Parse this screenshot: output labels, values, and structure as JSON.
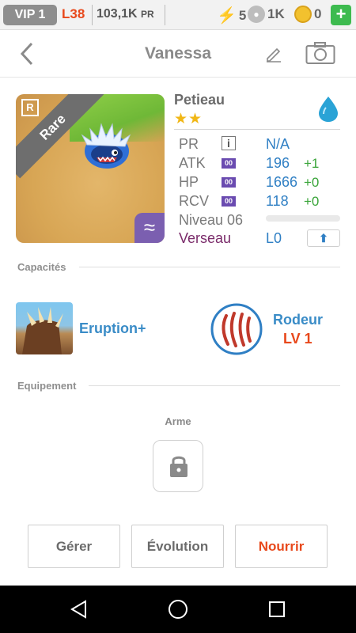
{
  "status_bar": {
    "vip": "VIP 1",
    "level": "L38",
    "pr_value": "103,1K",
    "pr_unit": "PR",
    "energy": "5",
    "paws": "1K",
    "coins": "0",
    "plus_label": "+"
  },
  "header": {
    "back_glyph": "‹",
    "title": "Vanessa",
    "icons": [
      "pencil-icon",
      "camera-icon"
    ]
  },
  "card": {
    "rarity": "Rare",
    "rarity_badge": "R",
    "element_glyph": "≈",
    "colors": {
      "banner": "#6e6e6e",
      "element_corner": "#7b5fb0"
    }
  },
  "info": {
    "species": "Petieau",
    "stars": "★★",
    "element_icon": "water-drop-icon",
    "rows": [
      {
        "label": "PR",
        "value": "N/A"
      },
      {
        "label": "ATK",
        "chip": "00",
        "value": "196",
        "bonus": "+1"
      },
      {
        "label": "HP",
        "chip": "00",
        "value": "1666",
        "bonus": "+0"
      },
      {
        "label": "RCV",
        "chip": "00",
        "value": "118",
        "bonus": "+0"
      }
    ],
    "level_label": "Niveau 06",
    "level_progress": 0,
    "sign": "Verseau",
    "sign_level": "L0",
    "info_glyph": "i",
    "up_glyph": "⬆"
  },
  "capacites": {
    "heading": "Capacités",
    "skill_name": "Eruption+",
    "trait_name": "Rodeur",
    "trait_level": "LV 1"
  },
  "equipement": {
    "heading": "Equipement",
    "slot_label": "Arme",
    "slot_icon": "lock-icon"
  },
  "actions": {
    "manage": "Gérer",
    "evolution": "Évolution",
    "feed": "Nourrir"
  },
  "colors": {
    "accent_blue": "#2f7fc4",
    "accent_orange": "#e8481b",
    "bonus_green": "#3aa53a",
    "sign_purple": "#7a2b6a"
  }
}
